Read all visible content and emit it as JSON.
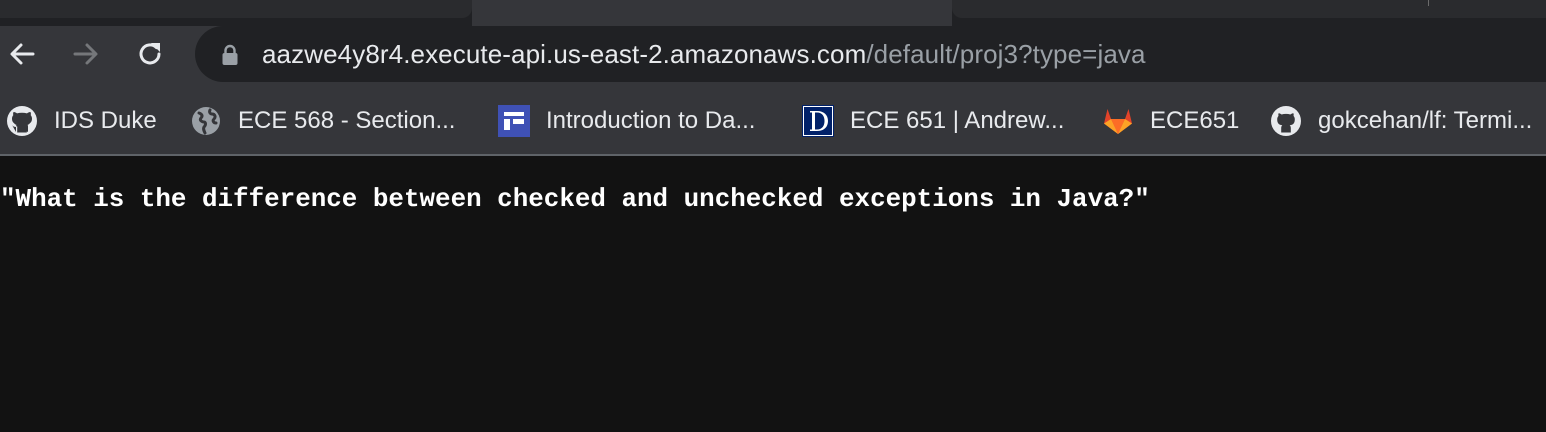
{
  "toolbar": {
    "back_icon": "arrow-left-icon",
    "forward_icon": "arrow-right-icon",
    "reload_icon": "reload-icon"
  },
  "address_bar": {
    "secure_icon": "lock-icon",
    "host": "aazwe4y8r4.execute-api.us-east-2.amazonaws.com",
    "path": "/default/proj3?type=java"
  },
  "bookmarks": [
    {
      "label": "IDS Duke",
      "icon": "github-icon"
    },
    {
      "label": "ECE 568 - Section...",
      "icon": "globe-icon"
    },
    {
      "label": "Introduction to Da...",
      "icon": "blue-page-icon"
    },
    {
      "label": "ECE 651 | Andrew...",
      "icon": "duke-d-icon"
    },
    {
      "label": "ECE651",
      "icon": "gitlab-icon"
    },
    {
      "label": "gokcehan/lf: Termi...",
      "icon": "github-icon"
    }
  ],
  "page": {
    "response_text": "\"What is the difference between checked and unchecked exceptions in Java?\""
  },
  "colors": {
    "toolbar_bg": "#35363a",
    "omnibox_bg": "#202124",
    "page_bg": "#121212",
    "text": "#e8eaed",
    "url_path": "#9aa0a6"
  }
}
